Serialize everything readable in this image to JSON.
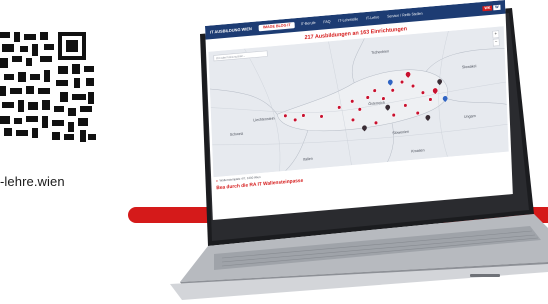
{
  "qr": {
    "url_text": "-lehre.wien"
  },
  "app": {
    "brand": "IT AUSBILDUNG WIEN",
    "nav": {
      "active": "IMAGE BLOG IT",
      "items": [
        "IT-Berufe",
        "FAQ",
        "IT-Lehrstelle",
        "IT-Lehre",
        "Service / Reife Stellen"
      ]
    },
    "logo": {
      "left": "WK",
      "right": "W"
    },
    "headline": "217 Ausbildungen an 163 Einrichtungen",
    "map": {
      "search_placeholder": "Ort oder Firma suchen...",
      "zoom_in": "+",
      "zoom_out": "−",
      "places": {
        "tschechien": "Tschechien",
        "slowakei": "Slowakei",
        "osterreich": "Österreich",
        "liechtenstein": "Liechtenstein",
        "schweiz": "Schweiz",
        "ungarn": "Ungarn",
        "slowenien": "Slowenien",
        "kroatien": "Kroatien",
        "italien": "Italien"
      }
    },
    "listing": {
      "meta": "Wallensteinplatz 4/7, 1200 Wien",
      "title": "Bea durch die RA IT Wallensteinpasse"
    }
  },
  "colors": {
    "brand_red": "#d51a1a",
    "nav_blue": "#1d3c73",
    "map_bg": "#e7eaef"
  }
}
